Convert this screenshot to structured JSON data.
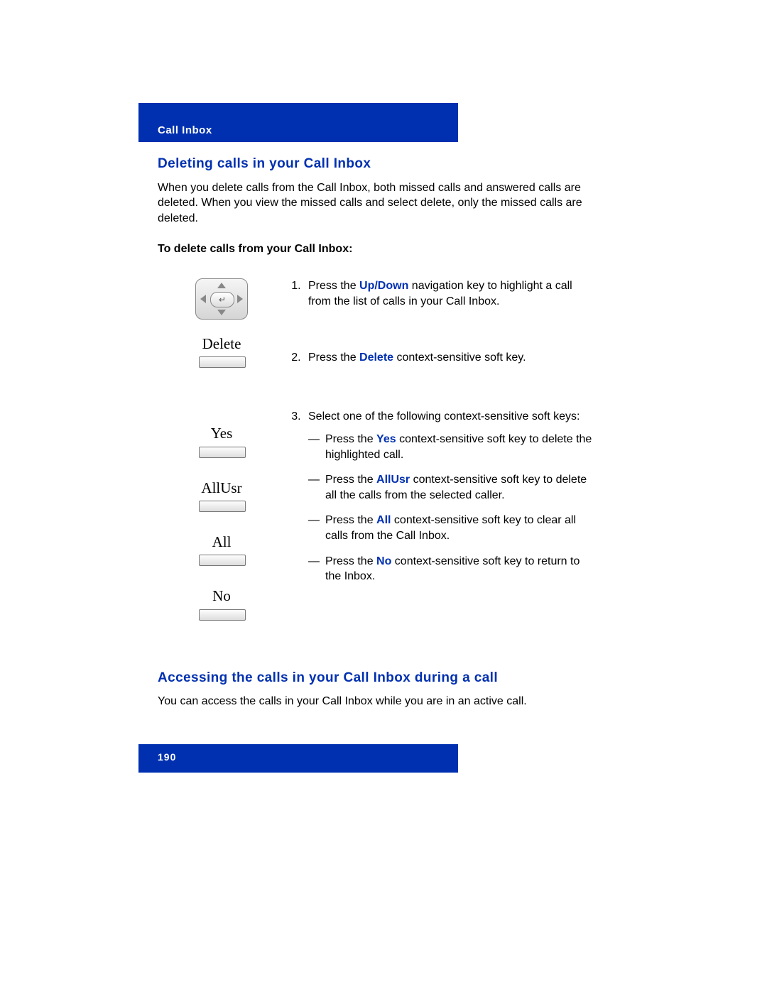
{
  "header": {
    "section": "Call Inbox"
  },
  "section1": {
    "title": "Deleting calls in your Call Inbox",
    "intro": "When you delete calls from the Call Inbox, both missed calls and answered calls are deleted. When you view the missed calls and select delete, only the missed calls are deleted.",
    "subhead": "To delete calls from your Call Inbox:",
    "softkeys": {
      "delete": "Delete",
      "yes": "Yes",
      "allusr": "AllUsr",
      "all": "All",
      "no": "No"
    },
    "step1": {
      "pre": "Press the ",
      "key": "Up/Down",
      "post": " navigation key to highlight a call from the list of calls in your Call Inbox."
    },
    "step2": {
      "pre": "Press the ",
      "key": "Delete",
      "post": " context-sensitive soft key."
    },
    "step3": {
      "lead": "Select one of the following context-sensitive soft keys:",
      "yes": {
        "pre": "Press the ",
        "key": "Yes",
        "post": " context-sensitive soft key to delete the highlighted call."
      },
      "allusr": {
        "pre": "Press the ",
        "key": "AllUsr",
        "post": " context-sensitive soft key to delete all the calls from the selected caller."
      },
      "all": {
        "pre": "Press the ",
        "key": "All",
        "post": " context-sensitive soft key to clear all calls from the Call Inbox."
      },
      "no": {
        "pre": "Press the ",
        "key": "No",
        "post": " context-sensitive soft key to return to the Inbox."
      }
    }
  },
  "section2": {
    "title": "Accessing the calls in your Call Inbox during a call",
    "body": "You can access the calls in your Call Inbox while you are in an active call."
  },
  "footer": {
    "page": "190"
  }
}
